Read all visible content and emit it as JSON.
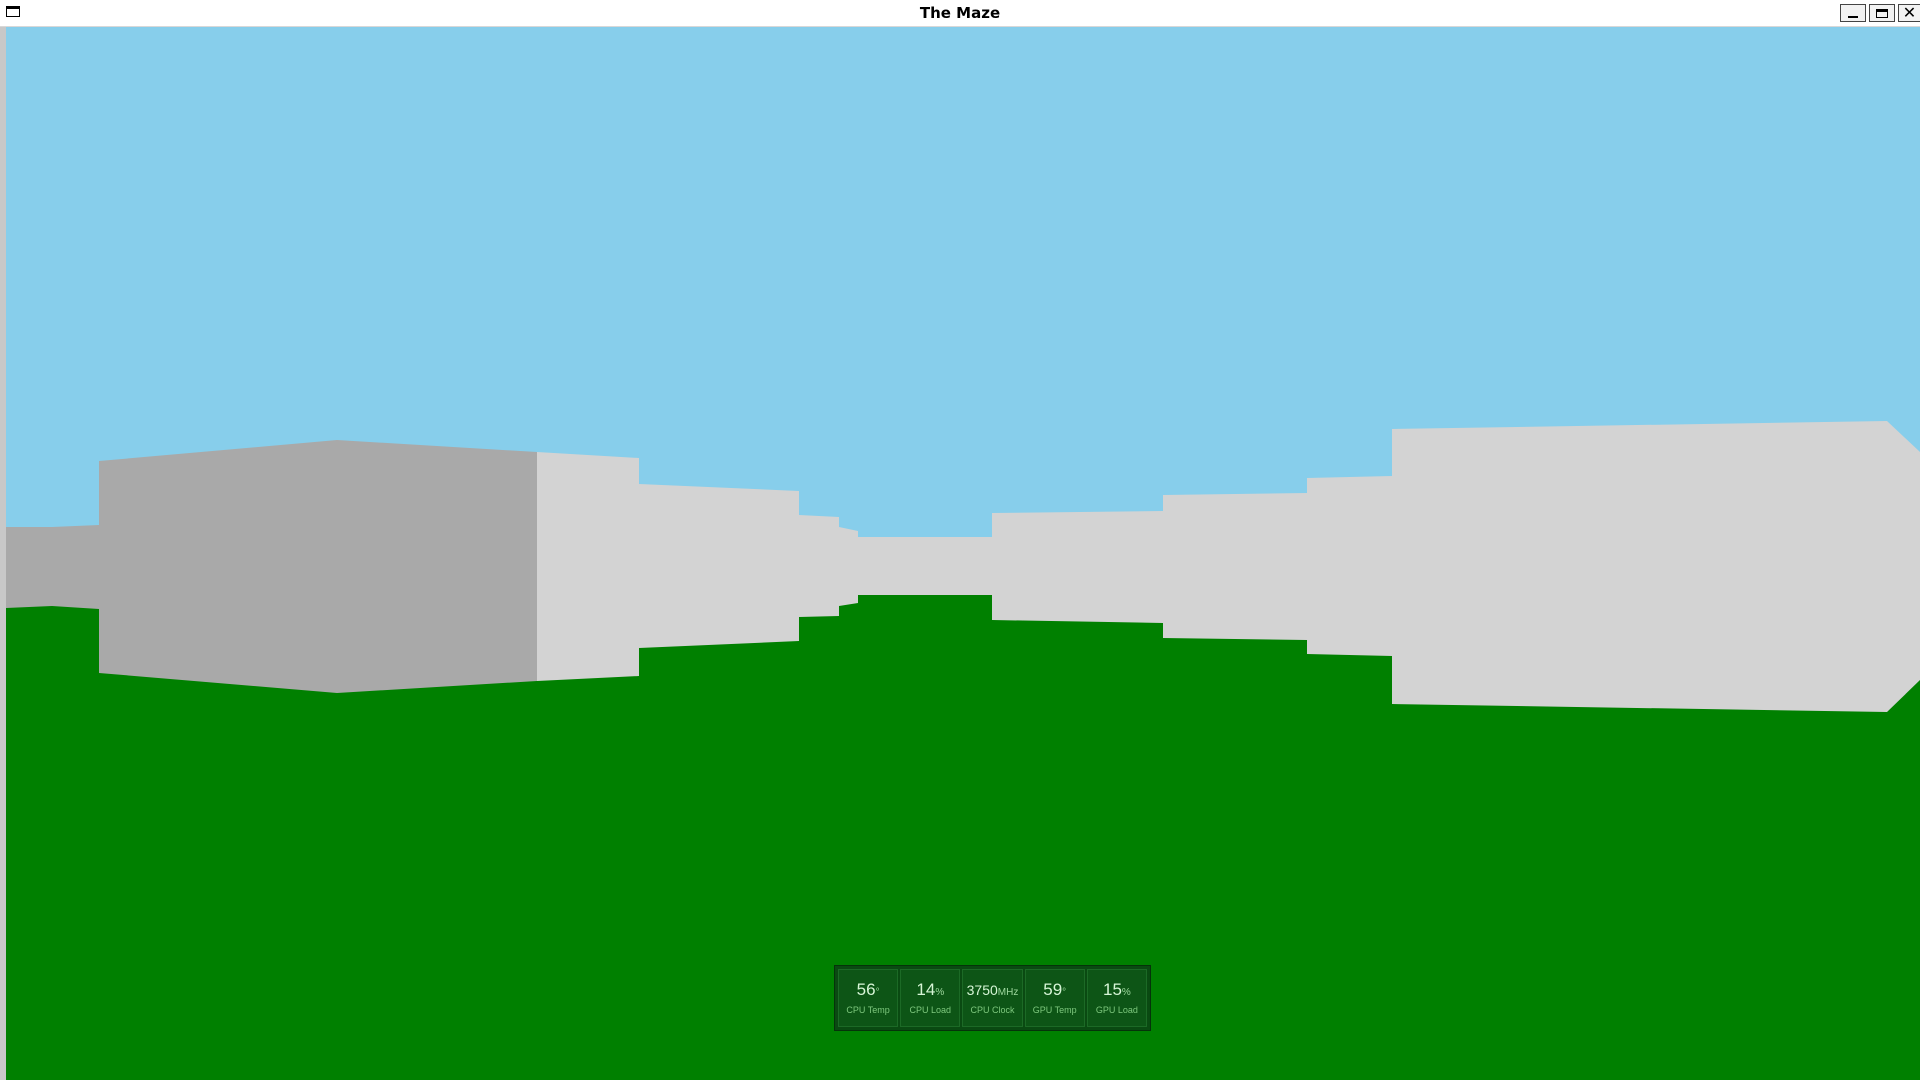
{
  "window": {
    "title": "The Maze",
    "icons": {
      "app": "window-icon",
      "minimize": "minimize-icon",
      "maximize": "maximize-icon",
      "close": "close-icon"
    }
  },
  "scene": {
    "colors": {
      "sky": "#87ceeb",
      "floor": "#008000",
      "wall_lit": "#d3d3d3",
      "wall_shaded": "#a9a9a9"
    }
  },
  "hud": {
    "items": [
      {
        "value": "56",
        "unit": "°",
        "label": "CPU Temp"
      },
      {
        "value": "14",
        "unit": "%",
        "label": "CPU Load"
      },
      {
        "value": "3750",
        "unit": "MHz",
        "label": "CPU Clock"
      },
      {
        "value": "59",
        "unit": "°",
        "label": "GPU Temp"
      },
      {
        "value": "15",
        "unit": "%",
        "label": "GPU Load"
      }
    ]
  }
}
